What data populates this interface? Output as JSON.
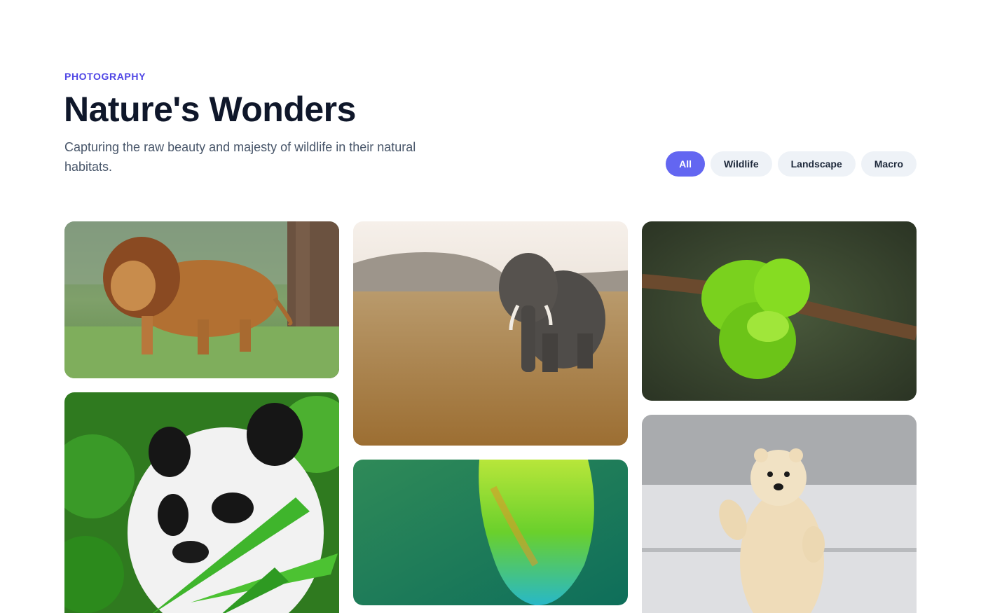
{
  "header": {
    "eyebrow": "PHOTOGRAPHY",
    "title": "Nature's Wonders",
    "subtitle": "Capturing the raw beauty and majesty of wildlife in their natural habitats."
  },
  "filters": [
    {
      "label": "All",
      "active": true
    },
    {
      "label": "Wildlife",
      "active": false
    },
    {
      "label": "Landscape",
      "active": false
    },
    {
      "label": "Macro",
      "active": false
    }
  ],
  "gallery": {
    "photos": [
      {
        "subject": "lion"
      },
      {
        "subject": "elephant"
      },
      {
        "subject": "green-snake"
      },
      {
        "subject": "panda"
      },
      {
        "subject": "parrot"
      },
      {
        "subject": "polar-bear"
      }
    ]
  },
  "colors": {
    "accent": "#6366f1",
    "eyebrow": "#4f46e5",
    "title": "#0f172a",
    "subtitle": "#475569",
    "chip_bg": "#eef2f7"
  }
}
